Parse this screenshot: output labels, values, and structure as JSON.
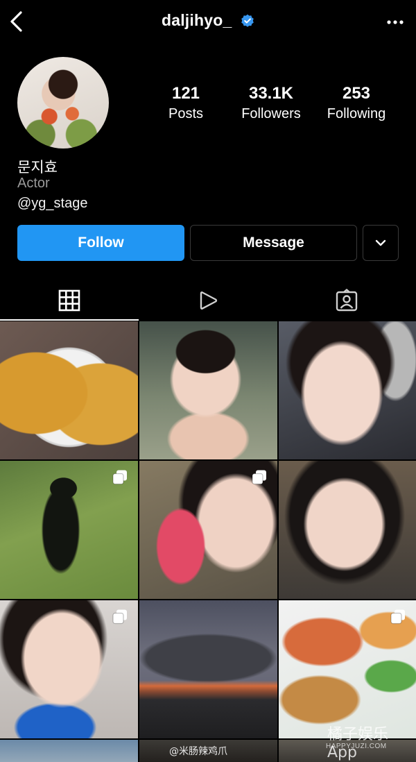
{
  "header": {
    "username": "daljihyo_"
  },
  "profile": {
    "stats": [
      {
        "value": "121",
        "label": "Posts"
      },
      {
        "value": "33.1K",
        "label": "Followers"
      },
      {
        "value": "253",
        "label": "Following"
      }
    ],
    "display_name": "문지효",
    "category": "Actor",
    "bio_handle": "@yg_stage"
  },
  "actions": {
    "follow_label": "Follow",
    "message_label": "Message"
  },
  "tabs": [
    {
      "icon": "grid-icon",
      "active": true
    },
    {
      "icon": "reels-icon",
      "active": false
    },
    {
      "icon": "tagged-icon",
      "active": false
    }
  ],
  "watermarks": {
    "site_name": "橘子娱乐App",
    "site_url": "HAPPYJUZI.COM",
    "weibo_credit": "@米肠辣鸡爪"
  },
  "colors": {
    "follow_button": "#2196f3",
    "background": "#000000",
    "verified_badge": "#3897f0",
    "secondary_text": "#9a9a9a"
  }
}
